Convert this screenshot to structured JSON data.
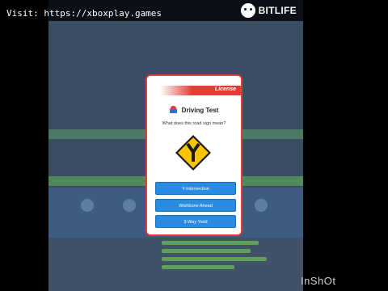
{
  "watermark": "Visit: https://xboxplay.games",
  "app_logo": {
    "text": "BITLIFE",
    "icon": "smiley-face-icon"
  },
  "modal": {
    "ribbon_label": "License",
    "title": "Driving Test",
    "title_icon": "car-icon",
    "question": "What does this road sign mean?",
    "sign_icon": "y-intersection-sign-icon",
    "answers": [
      "Y-Intersection",
      "Wishbone Ahead",
      "3-Way Yield"
    ]
  },
  "video_watermark": "InShOt",
  "colors": {
    "accent_red": "#e23d35",
    "button_blue": "#2a8ce0",
    "sign_yellow": "#f6c400",
    "overlay": "#3b4d63"
  }
}
